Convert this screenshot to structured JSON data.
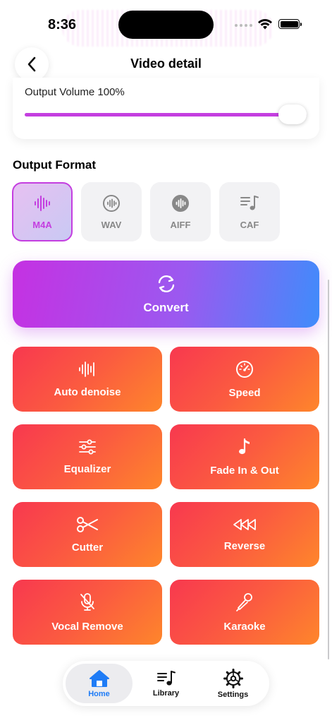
{
  "status_bar": {
    "time": "8:36"
  },
  "header": {
    "title": "Video detail"
  },
  "volume": {
    "label": "Output Volume 100%",
    "percent": 100
  },
  "output_format": {
    "title": "Output Format",
    "options": [
      {
        "label": "M4A",
        "icon": "waveform-icon",
        "selected": true
      },
      {
        "label": "WAV",
        "icon": "waveform-circle-icon",
        "selected": false
      },
      {
        "label": "AIFF",
        "icon": "waveform-circle-filled-icon",
        "selected": false
      },
      {
        "label": "CAF",
        "icon": "music-list-icon",
        "selected": false
      }
    ]
  },
  "convert": {
    "label": "Convert",
    "icon": "refresh-icon"
  },
  "tools": [
    {
      "label": "Auto denoise",
      "icon": "waveform-icon"
    },
    {
      "label": "Speed",
      "icon": "speedometer-icon"
    },
    {
      "label": "Equalizer",
      "icon": "sliders-icon"
    },
    {
      "label": "Fade In & Out",
      "icon": "music-note-icon"
    },
    {
      "label": "Cutter",
      "icon": "scissors-icon"
    },
    {
      "label": "Reverse",
      "icon": "rewind-icon"
    },
    {
      "label": "Vocal Remove",
      "icon": "mic-slash-icon"
    },
    {
      "label": "Karaoke",
      "icon": "karaoke-mic-icon"
    }
  ],
  "tabbar": {
    "items": [
      {
        "label": "Home",
        "icon": "home-icon",
        "active": true
      },
      {
        "label": "Library",
        "icon": "music-list-icon",
        "active": false
      },
      {
        "label": "Settings",
        "icon": "gear-icon",
        "active": false
      }
    ]
  },
  "colors": {
    "accent_purple": "#c43ee0",
    "convert_gradient": [
      "#c531e2",
      "#3f8cfb"
    ],
    "tool_gradient": [
      "#f8384f",
      "#fe862b"
    ],
    "active_tab": "#1f7cf6"
  }
}
